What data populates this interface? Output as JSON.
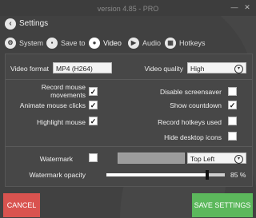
{
  "window": {
    "version": "version 4.85 - PRO",
    "close_glyph": "✕",
    "minimize_glyph": "—"
  },
  "header": {
    "back_icon": "back-arrow-icon",
    "title": "Settings"
  },
  "tabs": [
    {
      "label": "System",
      "icon": "gear-icon",
      "active": false
    },
    {
      "label": "Save to",
      "icon": "save-icon",
      "active": false
    },
    {
      "label": "Video",
      "icon": "video-icon",
      "active": true
    },
    {
      "label": "Audio",
      "icon": "audio-icon",
      "active": false
    },
    {
      "label": "Hotkeys",
      "icon": "keyboard-icon",
      "active": false
    }
  ],
  "video": {
    "format_label": "Video format",
    "format_value": "MP4 (H264)",
    "quality_label": "Video quality",
    "quality_value": "High"
  },
  "options_left": [
    {
      "label": "Record mouse movements",
      "checked": true
    },
    {
      "label": "Animate mouse clicks",
      "checked": true
    },
    {
      "label": "Highlight mouse",
      "checked": true
    }
  ],
  "options_right": [
    {
      "label": "Disable screensaver",
      "checked": false
    },
    {
      "label": "Show countdown",
      "checked": true
    },
    {
      "label": "Record hotkeys used",
      "checked": false
    },
    {
      "label": "Hide desktop icons",
      "checked": false
    }
  ],
  "watermark": {
    "label": "Watermark",
    "checked": false,
    "position_value": "Top Left",
    "opacity_label": "Watermark opacity",
    "opacity_value": 85,
    "opacity_text": "85 %"
  },
  "buttons": {
    "cancel": "CANCEL",
    "save": "SAVE SETTINGS"
  },
  "colors": {
    "cancel": "#d9534f",
    "save": "#5cb85c",
    "bg": "#414141"
  },
  "check_glyph": "✓"
}
